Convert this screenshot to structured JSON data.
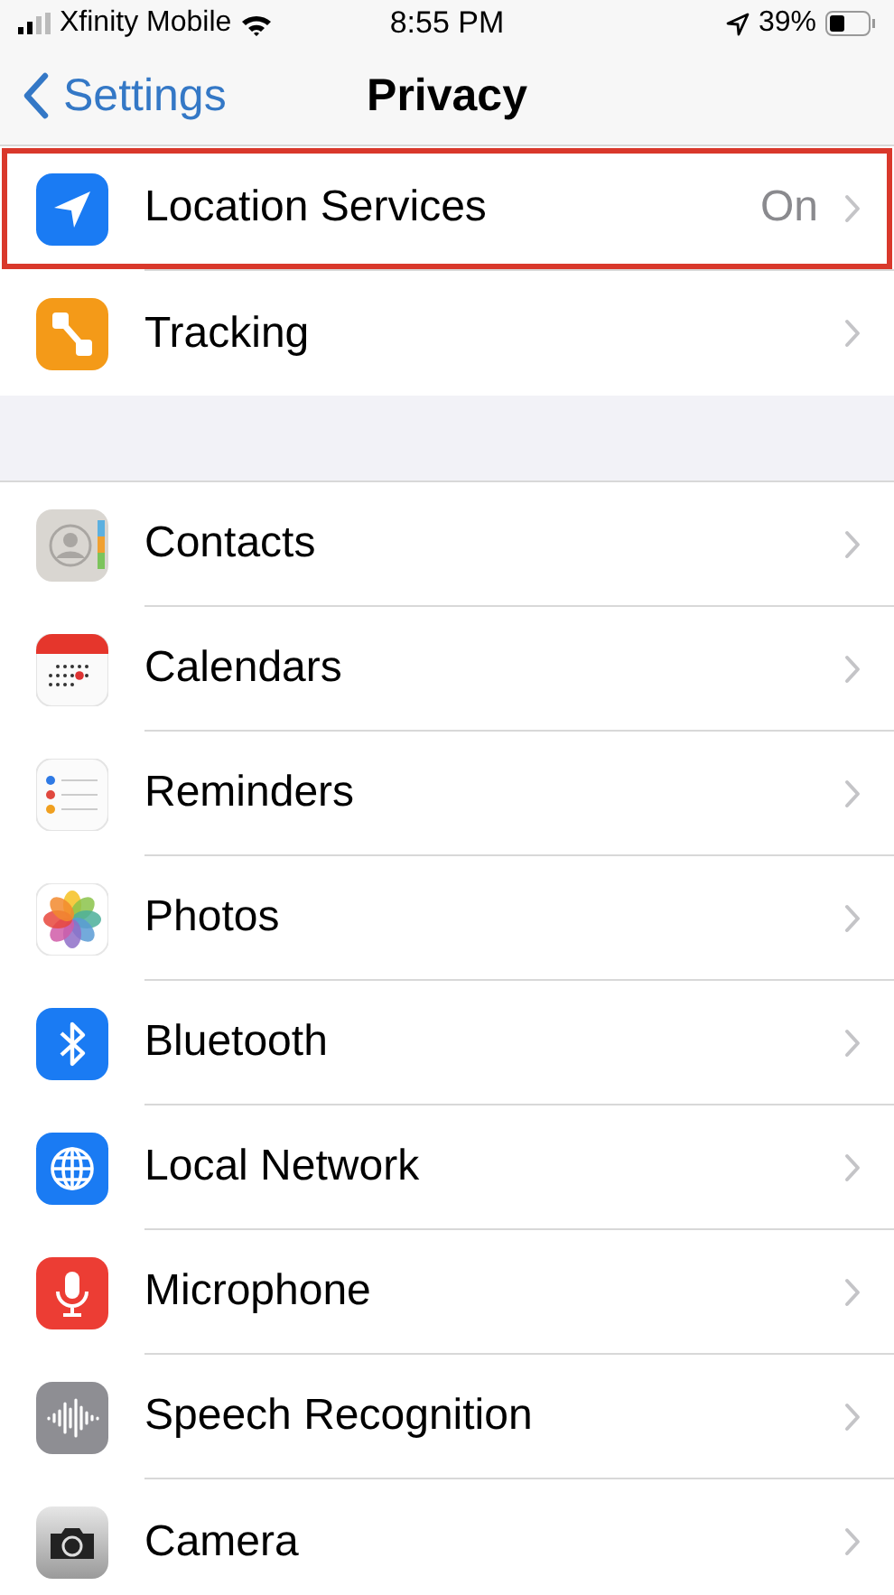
{
  "status_bar": {
    "carrier": "Xfinity Mobile",
    "time": "8:55 PM",
    "battery": "39%"
  },
  "nav_bar": {
    "back": "Settings",
    "title": "Privacy"
  },
  "sections": [
    {
      "items": [
        {
          "label": "Location Services",
          "value": "On",
          "highlighted": true
        },
        {
          "label": "Tracking",
          "highlighted": false
        }
      ]
    },
    {
      "items": [
        {
          "label": "Contacts",
          "highlighted": false
        },
        {
          "label": "Calendars",
          "highlighted": false
        },
        {
          "label": "Reminders",
          "highlighted": false
        },
        {
          "label": "Photos",
          "highlighted": false
        },
        {
          "label": "Bluetooth",
          "highlighted": false
        },
        {
          "label": "Local Network",
          "highlighted": false
        },
        {
          "label": "Microphone",
          "highlighted": false
        },
        {
          "label": "Speech Recognition",
          "highlighted": false
        },
        {
          "label": "Camera",
          "highlighted": false
        }
      ]
    }
  ]
}
